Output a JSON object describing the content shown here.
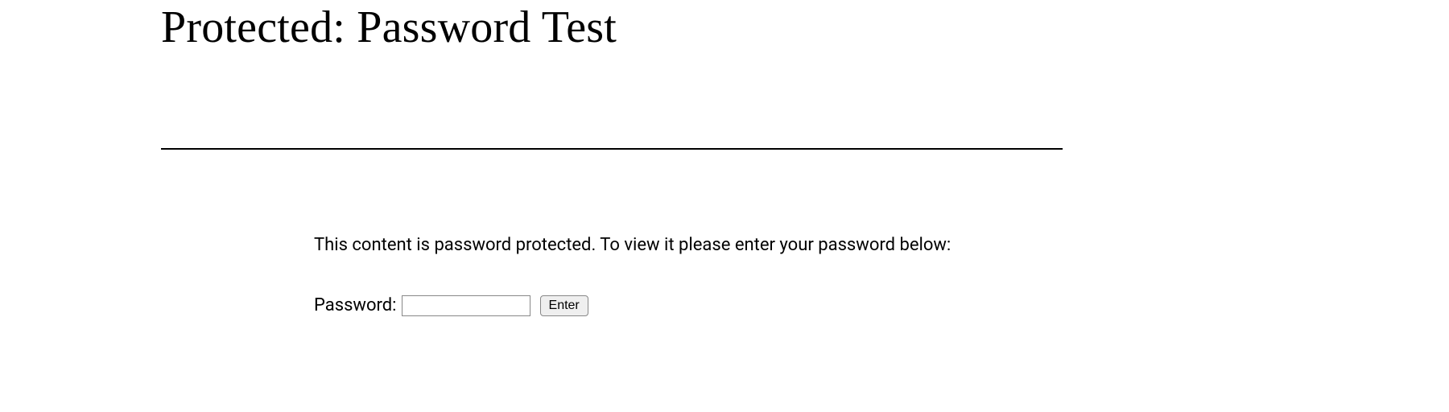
{
  "title": "Protected: Password Test",
  "message": "This content is password protected. To view it please enter your password below:",
  "form": {
    "label": "Password:",
    "input_value": "",
    "submit_label": "Enter"
  }
}
